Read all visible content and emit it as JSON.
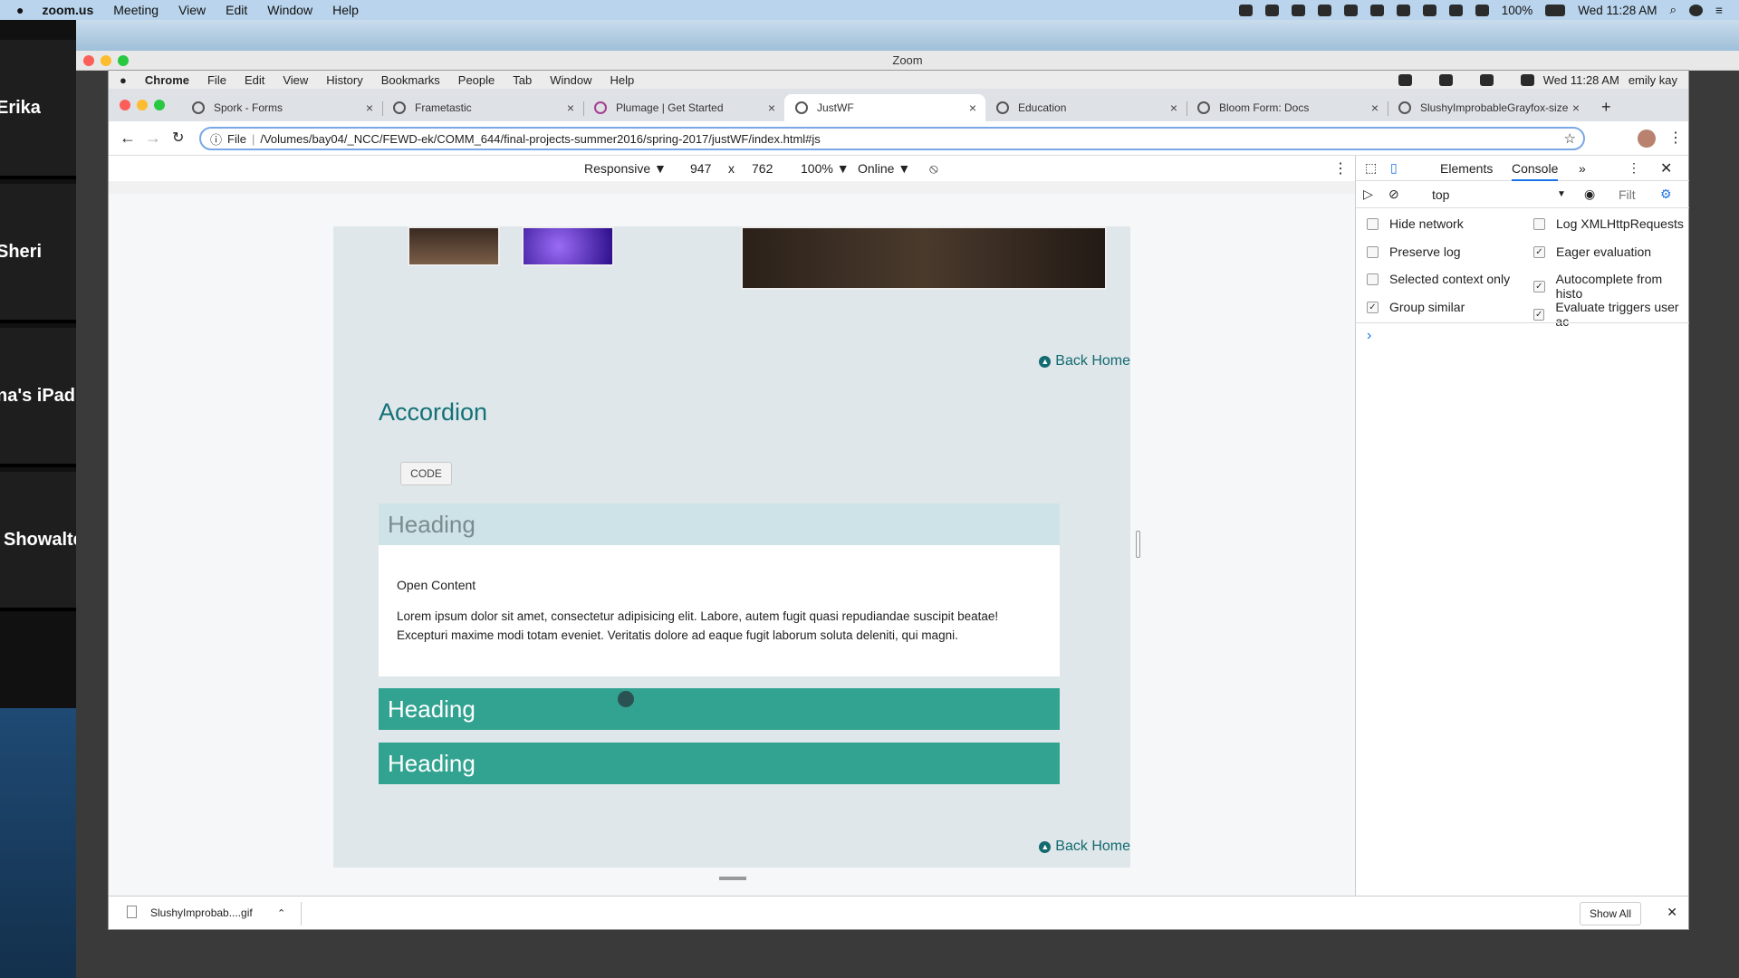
{
  "menubar": {
    "apple": "",
    "app": "zoom.us",
    "items": [
      "Meeting",
      "View",
      "Edit",
      "Window",
      "Help"
    ],
    "battery": "100%",
    "clock": "Wed 11:28 AM"
  },
  "zoom": {
    "title": "Zoom",
    "participants": [
      "Erika",
      "Sheri",
      "na's iPad",
      "Showalte"
    ]
  },
  "chrome": {
    "menu": [
      "Chrome",
      "File",
      "Edit",
      "View",
      "History",
      "Bookmarks",
      "People",
      "Tab",
      "Window",
      "Help"
    ],
    "clock": "Wed 11:28 AM",
    "user": "emily kay",
    "tabs": [
      {
        "label": "Spork - Forms"
      },
      {
        "label": "Frametastic"
      },
      {
        "label": "Plumage | Get Started"
      },
      {
        "label": "JustWF"
      },
      {
        "label": "Education"
      },
      {
        "label": "Bloom Form: Docs"
      },
      {
        "label": "SlushyImprobableGrayfox-size"
      }
    ],
    "new_tab": "+",
    "url_scheme": "File",
    "url": "/Volumes/bay04/_NCC/FEWD-ek/COMM_644/final-projects-summer2016/spring-2017/justWF/index.html#js"
  },
  "device_toolbar": {
    "mode": "Responsive ▼",
    "width": "947",
    "times": "x",
    "height": "762",
    "zoom": "100% ▼",
    "network": "Online ▼"
  },
  "page": {
    "back_home": "Back Home",
    "accordion_title": "Accordion",
    "code_button": "CODE",
    "headings": [
      "Heading",
      "Heading",
      "Heading"
    ],
    "open_content": "Open Content",
    "lorem": "Lorem ipsum dolor sit amet, consectetur adipisicing elit. Labore, autem fugit quasi repudiandae suscipit beatae! Excepturi maxime modi totam eveniet. Veritatis dolore ad eaque fugit laborum soluta deleniti, qui magni."
  },
  "devtools": {
    "tabs": [
      "Elements",
      "Console"
    ],
    "active_tab": "Console",
    "more": "»",
    "context": "top",
    "filter": "Filt",
    "options": [
      {
        "label": "Hide network",
        "checked": false
      },
      {
        "label": "Log XMLHttpRequests",
        "checked": false
      },
      {
        "label": "Preserve log",
        "checked": false
      },
      {
        "label": "Eager evaluation",
        "checked": true
      },
      {
        "label": "Selected context only",
        "checked": false
      },
      {
        "label": "Autocomplete from histo",
        "checked": true
      },
      {
        "label": "Group similar",
        "checked": true
      },
      {
        "label": "Evaluate triggers user ac",
        "checked": true
      }
    ],
    "prompt": "›"
  },
  "shelf": {
    "file": "SlushyImprobab....gif",
    "show_all": "Show All"
  },
  "colors": {
    "accent_teal": "#33a391",
    "title_teal": "#137177",
    "active_devtools": "#1a73e8"
  }
}
